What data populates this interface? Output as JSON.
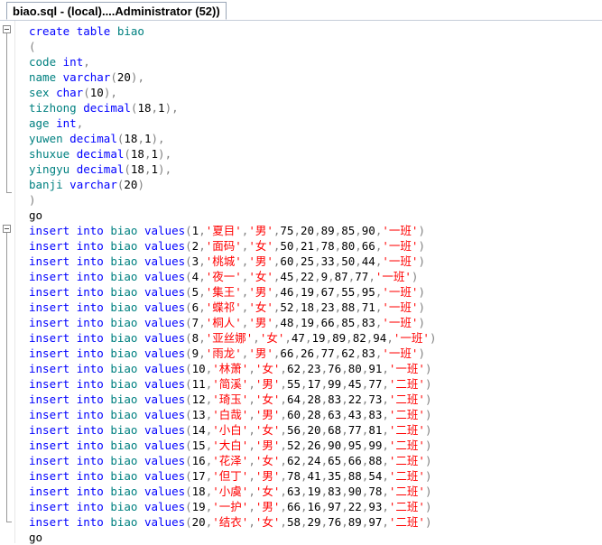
{
  "tab": {
    "title": "biao.sql - (local)....Administrator (52))"
  },
  "lines": [
    "create table biao",
    "(",
    "code int,",
    "name varchar(20),",
    "sex char(10),",
    "tizhong decimal(18,1),",
    "age int,",
    "yuwen decimal(18,1),",
    "shuxue decimal(18,1),",
    "yingyu decimal(18,1),",
    "banji varchar(20)",
    ")",
    "go",
    "insert into biao values(1,'夏目','男',75,20,89,85,90,'一班')",
    "insert into biao values(2,'面码','女',50,21,78,80,66,'一班')",
    "insert into biao values(3,'桃城','男',60,25,33,50,44,'一班')",
    "insert into biao values(4,'夜一','女',45,22,9,87,77,'一班')",
    "insert into biao values(5,'集王','男',46,19,67,55,95,'一班')",
    "insert into biao values(6,'蝶祁','女',52,18,23,88,71,'一班')",
    "insert into biao values(7,'桐人','男',48,19,66,85,83,'一班')",
    "insert into biao values(8,'亚丝娜','女',47,19,89,82,94,'一班')",
    "insert into biao values(9,'雨龙','男',66,26,77,62,83,'一班')",
    "insert into biao values(10,'林萧','女',62,23,76,80,91,'一班')",
    "insert into biao values(11,'简溪','男',55,17,99,45,77,'二班')",
    "insert into biao values(12,'琦玉','女',64,28,83,22,73,'二班')",
    "insert into biao values(13,'白哉','男',60,28,63,43,83,'二班')",
    "insert into biao values(14,'小白','女',56,20,68,77,81,'二班')",
    "insert into biao values(15,'大白','男',52,26,90,95,99,'二班')",
    "insert into biao values(16,'花泽','女',62,24,65,66,88,'二班')",
    "insert into biao values(17,'但丁','男',78,41,35,88,54,'二班')",
    "insert into biao values(18,'小虞','女',63,19,83,90,78,'二班')",
    "insert into biao values(19,'一护','男',66,16,97,22,93,'二班')",
    "insert into biao values(20,'结衣','女',58,29,76,89,97,'二班')",
    "go"
  ],
  "colors": {
    "keyword": "#0000ff",
    "string": "#ff0000",
    "punct": "#808080",
    "identifier": "#008080"
  }
}
